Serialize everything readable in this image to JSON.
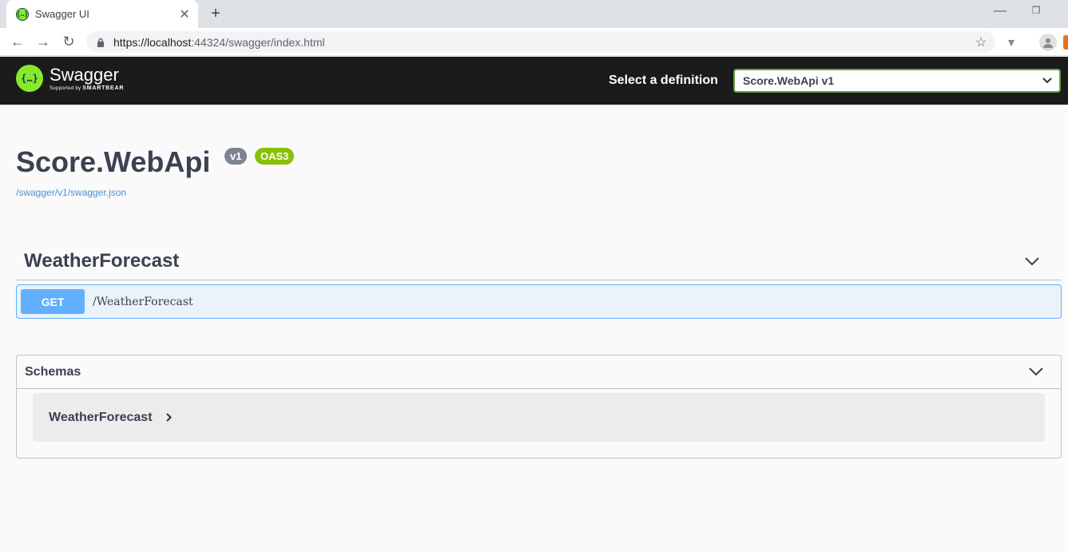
{
  "browser": {
    "tab_title": "Swagger UI",
    "url_host": "https://localhost",
    "url_rest": ":44324/swagger/index.html"
  },
  "topbar": {
    "logo_name": "Swagger",
    "logo_sub_prefix": "Supported by",
    "logo_sub_brand": "SMARTBEAR",
    "definition_label": "Select a definition",
    "definition_value": "Score.WebApi v1"
  },
  "info": {
    "title": "Score.WebApi",
    "version_badge": "v1",
    "oas_badge": "OAS3",
    "spec_link": "/swagger/v1/swagger.json"
  },
  "operations": {
    "tag": "WeatherForecast",
    "items": [
      {
        "method": "GET",
        "path": "/WeatherForecast"
      }
    ]
  },
  "schemas": {
    "title": "Schemas",
    "models": [
      "WeatherForecast"
    ]
  },
  "colors": {
    "get": "#61affe",
    "brand_green": "#85ea2d",
    "oas_green": "#89bf04"
  }
}
